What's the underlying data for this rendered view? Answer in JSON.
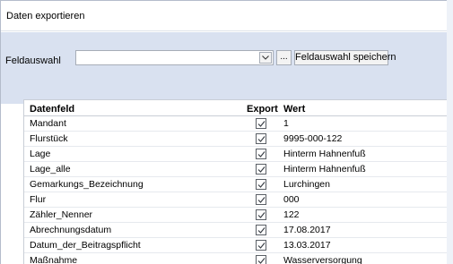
{
  "window": {
    "title": "Daten exportieren"
  },
  "toolbar": {
    "feldauswahl_label": "Feldauswahl",
    "feldauswahl_value": "",
    "ellipsis_label": "...",
    "save_label": "Feldauswahl speichern",
    "dropdown_icon": "chevron-down-icon"
  },
  "table": {
    "headers": {
      "field": "Datenfeld",
      "export": "Export",
      "value": "Wert"
    },
    "rows": [
      {
        "field": "Mandant",
        "export": true,
        "value": "1"
      },
      {
        "field": "Flurstück",
        "export": true,
        "value": "9995-000-122"
      },
      {
        "field": "Lage",
        "export": true,
        "value": "Hinterm Hahnenfuß"
      },
      {
        "field": "Lage_alle",
        "export": true,
        "value": "Hinterm Hahnenfuß"
      },
      {
        "field": "Gemarkungs_Bezeichnung",
        "export": true,
        "value": "Lurchingen"
      },
      {
        "field": "Flur",
        "export": true,
        "value": "000"
      },
      {
        "field": "Zähler_Nenner",
        "export": true,
        "value": "122"
      },
      {
        "field": "Abrechnungsdatum",
        "export": true,
        "value": "17.08.2017"
      },
      {
        "field": "Datum_der_Beitragspflicht",
        "export": true,
        "value": "13.03.2017"
      },
      {
        "field": "Maßnahme",
        "export": true,
        "value": "Wasserversorgung"
      }
    ]
  }
}
